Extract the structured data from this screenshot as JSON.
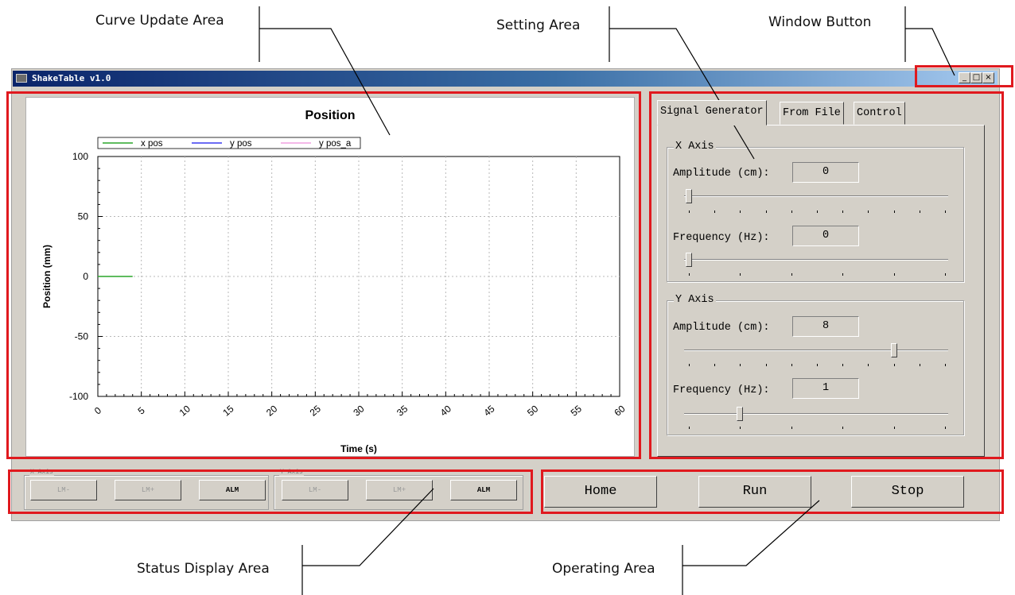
{
  "annotations": {
    "curve_update_area": "Curve Update Area",
    "setting_area": "Setting Area",
    "window_button": "Window Button",
    "status_display_area": "Status Display Area",
    "operating_area": "Operating Area"
  },
  "window": {
    "title": "ShakeTable v1.0",
    "buttons": {
      "minimize": "_",
      "maximize": "□",
      "close": "×"
    }
  },
  "chart_data": {
    "type": "line",
    "title": "Position",
    "xlabel": "Time (s)",
    "ylabel": "Position (mm)",
    "xlim": [
      0,
      60
    ],
    "ylim": [
      -100,
      100
    ],
    "x_ticks": [
      "0",
      "5",
      "10",
      "15",
      "20",
      "25",
      "30",
      "35",
      "40",
      "45",
      "50",
      "55",
      "60"
    ],
    "y_ticks": [
      "100",
      "50",
      "0",
      "-50",
      "-100"
    ],
    "grid": true,
    "legend_position": "top-left",
    "series": [
      {
        "name": "x pos",
        "color": "#2aa52a",
        "x": [
          0,
          4
        ],
        "y": [
          0,
          0
        ]
      },
      {
        "name": "y pos",
        "color": "#3a3af0",
        "x": [],
        "y": []
      },
      {
        "name": "y pos_a",
        "color": "#f0a0e0",
        "x": [],
        "y": []
      }
    ]
  },
  "tabs": [
    {
      "label": "Signal Generator",
      "active": true
    },
    {
      "label": "From File",
      "active": false
    },
    {
      "label": "Control",
      "active": false
    }
  ],
  "x_axis_group": {
    "label": "X Axis",
    "amplitude_label": "Amplitude (cm):",
    "amplitude_value": "0",
    "amplitude_slider_fraction": 0.0,
    "frequency_label": "Frequency (Hz):",
    "frequency_value": "0",
    "frequency_slider_fraction": 0.0
  },
  "y_axis_group": {
    "label": "Y Axis",
    "amplitude_label": "Amplitude (cm):",
    "amplitude_value": "8",
    "amplitude_slider_fraction": 0.8,
    "frequency_label": "Frequency (Hz):",
    "frequency_value": "1",
    "frequency_slider_fraction": 0.2
  },
  "status": {
    "x_group_label": "X Axis",
    "y_group_label": "Y Axis",
    "lim_minus": "LM-",
    "lim_plus": "LM+",
    "alm": "ALM"
  },
  "operations": {
    "home": "Home",
    "run": "Run",
    "stop": "Stop"
  },
  "colors": {
    "annotation_box": "#e0191e",
    "titlebar_start": "#0a246a",
    "titlebar_end": "#a6caf0",
    "panel_bg": "#d4d0c8"
  }
}
